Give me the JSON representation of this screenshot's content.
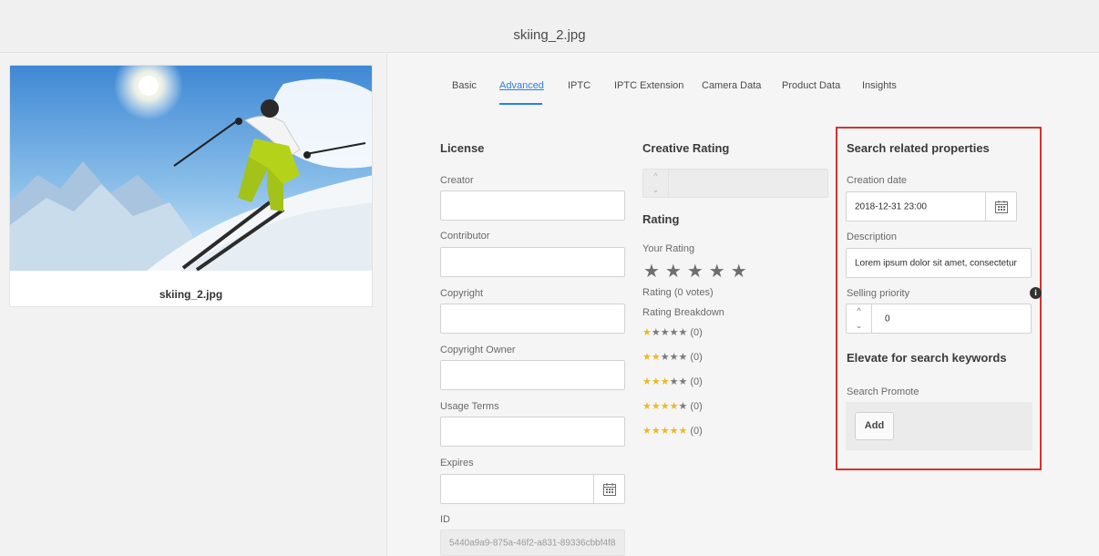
{
  "header": {
    "title": "skiing_2.jpg"
  },
  "asset": {
    "caption": "skiing_2.jpg"
  },
  "tabs": [
    {
      "label": "Basic"
    },
    {
      "label": "Advanced"
    },
    {
      "label": "IPTC"
    },
    {
      "label": "IPTC Extension"
    },
    {
      "label": "Camera Data"
    },
    {
      "label": "Product Data"
    },
    {
      "label": "Insights"
    }
  ],
  "license": {
    "title": "License",
    "creator_label": "Creator",
    "creator_value": "",
    "contributor_label": "Contributor",
    "contributor_value": "",
    "copyright_label": "Copyright",
    "copyright_value": "",
    "copyright_owner_label": "Copyright Owner",
    "copyright_owner_value": "",
    "usage_terms_label": "Usage Terms",
    "usage_terms_value": "",
    "expires_label": "Expires",
    "expires_value": "",
    "id_label": "ID",
    "id_value": "5440a9a9-875a-46f2-a831-89336cbbf4f8"
  },
  "creative_rating": {
    "title": "Creative Rating",
    "value": ""
  },
  "rating": {
    "title": "Rating",
    "your_rating_label": "Your Rating",
    "your_rating_stars": "★★★★★",
    "summary": "Rating (0 votes)",
    "breakdown_label": "Rating Breakdown",
    "breakdown": [
      {
        "yellow": "★",
        "gray": "★★★★",
        "count": "(0)"
      },
      {
        "yellow": "★★",
        "gray": "★★★",
        "count": "(0)"
      },
      {
        "yellow": "★★★",
        "gray": "★★",
        "count": "(0)"
      },
      {
        "yellow": "★★★★",
        "gray": "★",
        "count": "(0)"
      },
      {
        "yellow": "★★★★★",
        "gray": "",
        "count": "(0)"
      }
    ]
  },
  "search": {
    "title": "Search related properties",
    "creation_date_label": "Creation date",
    "creation_date_value": "2018-12-31 23:00",
    "description_label": "Description",
    "description_value": "Lorem ipsum dolor sit amet, consectetur",
    "selling_priority_label": "Selling priority",
    "selling_priority_value": "0",
    "elevate_title": "Elevate for search keywords",
    "search_promote_label": "Search Promote",
    "add_label": "Add",
    "info_glyph": "i"
  },
  "icons": {
    "chevron_up": "^",
    "chevron_down": "⌄"
  },
  "colors": {
    "accent": "#2680eb",
    "highlight_border": "#d9312b",
    "star_yellow": "#e9b92b"
  }
}
